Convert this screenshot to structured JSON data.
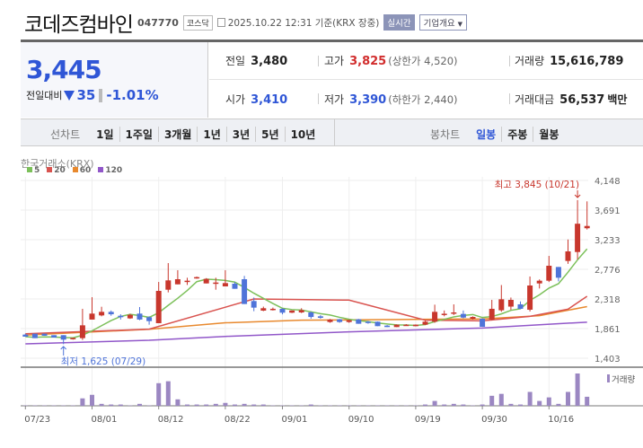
{
  "header": {
    "title": "코데즈컴바인",
    "code": "047770",
    "market": "코스닥",
    "datetime": "2025.10.22 12:31 기준(KRX 장중)",
    "realtime": "실시간",
    "company_info": "기업개요"
  },
  "price": {
    "current": "3,445",
    "change_label": "전일대비",
    "change": "35",
    "change_pct": "-1.01%"
  },
  "info": {
    "prev_label": "전일",
    "prev": "3,480",
    "high_label": "고가",
    "high": "3,825",
    "upper_limit": "(상한가 4,520)",
    "volume_label": "거래량",
    "volume": "15,616,789",
    "open_label": "시가",
    "open": "3,410",
    "low_label": "저가",
    "low": "3,390",
    "lower_limit": "(하한가 2,440)",
    "amount_label": "거래대금",
    "amount": "56,537",
    "amount_unit": "백만"
  },
  "tabs": {
    "line_label": "선차트",
    "line": [
      "1일",
      "1주일",
      "3개월",
      "1년",
      "3년",
      "5년",
      "10년"
    ],
    "candle_label": "봉차트",
    "candle": [
      "일봉",
      "주봉",
      "월봉"
    ],
    "candle_active": 0
  },
  "colors": {
    "up": "#c8372d",
    "down": "#4f74d9",
    "ma5": "#7cc05a",
    "ma20": "#d9534f",
    "ma60": "#e8892e",
    "ma120": "#9157c9",
    "volume": "#9b87c2"
  },
  "chart_data": {
    "type": "candlestick",
    "source": "한국거래소(KRX)",
    "legend": [
      "5",
      "20",
      "60",
      "120"
    ],
    "y_ticks": [
      "4,148",
      "3,691",
      "3,233",
      "2,776",
      "2,318",
      "1,861",
      "1,403"
    ],
    "y_tick_values": [
      4148,
      3691,
      3233,
      2776,
      2318,
      1861,
      1403
    ],
    "ylim": [
      1403,
      4148
    ],
    "x_labels": [
      {
        "i": 0,
        "t": "07/23"
      },
      {
        "i": 7,
        "t": "08/01"
      },
      {
        "i": 14,
        "t": "08/12"
      },
      {
        "i": 21,
        "t": "08/22"
      },
      {
        "i": 27,
        "t": "09/01"
      },
      {
        "i": 34,
        "t": "09/10"
      },
      {
        "i": 41,
        "t": "09/19"
      },
      {
        "i": 48,
        "t": "09/30"
      },
      {
        "i": 55,
        "t": "10/16"
      }
    ],
    "max_annotation": {
      "i": 58,
      "text": "최고 3,845 (10/21)",
      "value": 3845
    },
    "min_annotation": {
      "i": 4,
      "text": "최저 1,625 (07/29)",
      "value": 1625
    },
    "volume_label": "거래량",
    "ohlc": [
      [
        1768,
        1782,
        1736,
        1736
      ],
      [
        1782,
        1782,
        1713,
        1713
      ],
      [
        1782,
        1782,
        1750,
        1750
      ],
      [
        1759,
        1759,
        1722,
        1722
      ],
      [
        1759,
        1759,
        1620,
        1690
      ],
      [
        1704,
        1720,
        1690,
        1716
      ],
      [
        1713,
        2166,
        1685,
        1911
      ],
      [
        2000,
        2346,
        2000,
        2092
      ],
      [
        2064,
        2198,
        2050,
        2119
      ],
      [
        2119,
        2140,
        2059,
        2082
      ],
      [
        2059,
        2082,
        2000,
        2036
      ],
      [
        2018,
        2090,
        2010,
        2073
      ],
      [
        2092,
        2193,
        1990,
        2000
      ],
      [
        2036,
        2050,
        1921,
        1976
      ],
      [
        1944,
        2581,
        1944,
        2443
      ],
      [
        2461,
        2872,
        2420,
        2605
      ],
      [
        2544,
        2762,
        2544,
        2623
      ],
      [
        2591,
        2646,
        2535,
        2600
      ],
      [
        2637,
        2665,
        2630,
        2655
      ],
      [
        2558,
        2640,
        2558,
        2628
      ],
      [
        2572,
        2646,
        2461,
        2572
      ],
      [
        2512,
        2762,
        2512,
        2563
      ],
      [
        2554,
        2580,
        2475,
        2475
      ],
      [
        2623,
        2674,
        2240,
        2240
      ],
      [
        2286,
        2340,
        2129,
        2184
      ],
      [
        2138,
        2200,
        2130,
        2175
      ],
      [
        2166,
        2185,
        2140,
        2166
      ],
      [
        2166,
        2175,
        2080,
        2106
      ],
      [
        2106,
        2140,
        2100,
        2140
      ],
      [
        2110,
        2175,
        2100,
        2145
      ],
      [
        2110,
        2125,
        2013,
        2040
      ],
      [
        2050,
        2070,
        2013,
        2027
      ],
      [
        1962,
        2010,
        1950,
        2000
      ],
      [
        2004,
        2010,
        1950,
        1962
      ],
      [
        1962,
        2000,
        1950,
        1990
      ],
      [
        2004,
        2010,
        1935,
        1935
      ],
      [
        1967,
        1980,
        1935,
        1953
      ],
      [
        1967,
        1970,
        1898,
        1898
      ],
      [
        1907,
        1915,
        1884,
        1884
      ],
      [
        1884,
        1925,
        1884,
        1921
      ],
      [
        1916,
        1930,
        1905,
        1920
      ],
      [
        1898,
        1925,
        1895,
        1921
      ],
      [
        1921,
        1980,
        1915,
        1967
      ],
      [
        1967,
        2230,
        1950,
        2119
      ],
      [
        2073,
        2140,
        2050,
        2090
      ],
      [
        2100,
        2235,
        2070,
        2110
      ],
      [
        2087,
        2140,
        2020,
        2030
      ],
      [
        2013,
        2050,
        2000,
        2040
      ],
      [
        2013,
        2020,
        1888,
        1888
      ],
      [
        2000,
        2304,
        1990,
        2166
      ],
      [
        2143,
        2533,
        2120,
        2313
      ],
      [
        2200,
        2340,
        2150,
        2304
      ],
      [
        2235,
        2280,
        2160,
        2166
      ],
      [
        2152,
        2665,
        2125,
        2526
      ],
      [
        2558,
        2620,
        2480,
        2600
      ],
      [
        2600,
        2983,
        2580,
        2831
      ],
      [
        2812,
        2812,
        2590,
        2646
      ],
      [
        2905,
        3237,
        2860,
        3053
      ],
      [
        3043,
        3845,
        2930,
        3480
      ],
      [
        3410,
        3825,
        3390,
        3445
      ]
    ],
    "volume_relative": [
      1,
      1,
      1,
      1,
      1,
      1,
      23,
      34,
      6,
      4,
      4,
      1,
      6,
      1,
      70,
      76,
      20,
      4,
      4,
      4,
      6,
      9,
      4,
      6,
      4,
      4,
      1,
      1,
      1,
      1,
      4,
      1,
      1,
      1,
      1,
      1,
      1,
      1,
      1,
      1,
      1,
      1,
      4,
      15,
      4,
      6,
      4,
      1,
      4,
      31,
      37,
      6,
      4,
      43,
      15,
      26,
      6,
      43,
      100,
      28
    ],
    "ma20": [
      [
        0,
        1780
      ],
      [
        13,
        1852
      ],
      [
        24,
        2318
      ],
      [
        34,
        2300
      ],
      [
        42,
        1990
      ],
      [
        48,
        1980
      ],
      [
        53,
        2050
      ],
      [
        57,
        2160
      ],
      [
        59,
        2360
      ]
    ],
    "ma60": [
      [
        0,
        1760
      ],
      [
        13,
        1850
      ],
      [
        21,
        1950
      ],
      [
        29,
        1990
      ],
      [
        48,
        2010
      ],
      [
        54,
        2060
      ],
      [
        59,
        2200
      ]
    ],
    "ma120": [
      [
        0,
        1625
      ],
      [
        13,
        1680
      ],
      [
        21,
        1740
      ],
      [
        34,
        1810
      ],
      [
        48,
        1870
      ],
      [
        59,
        1960
      ]
    ]
  }
}
